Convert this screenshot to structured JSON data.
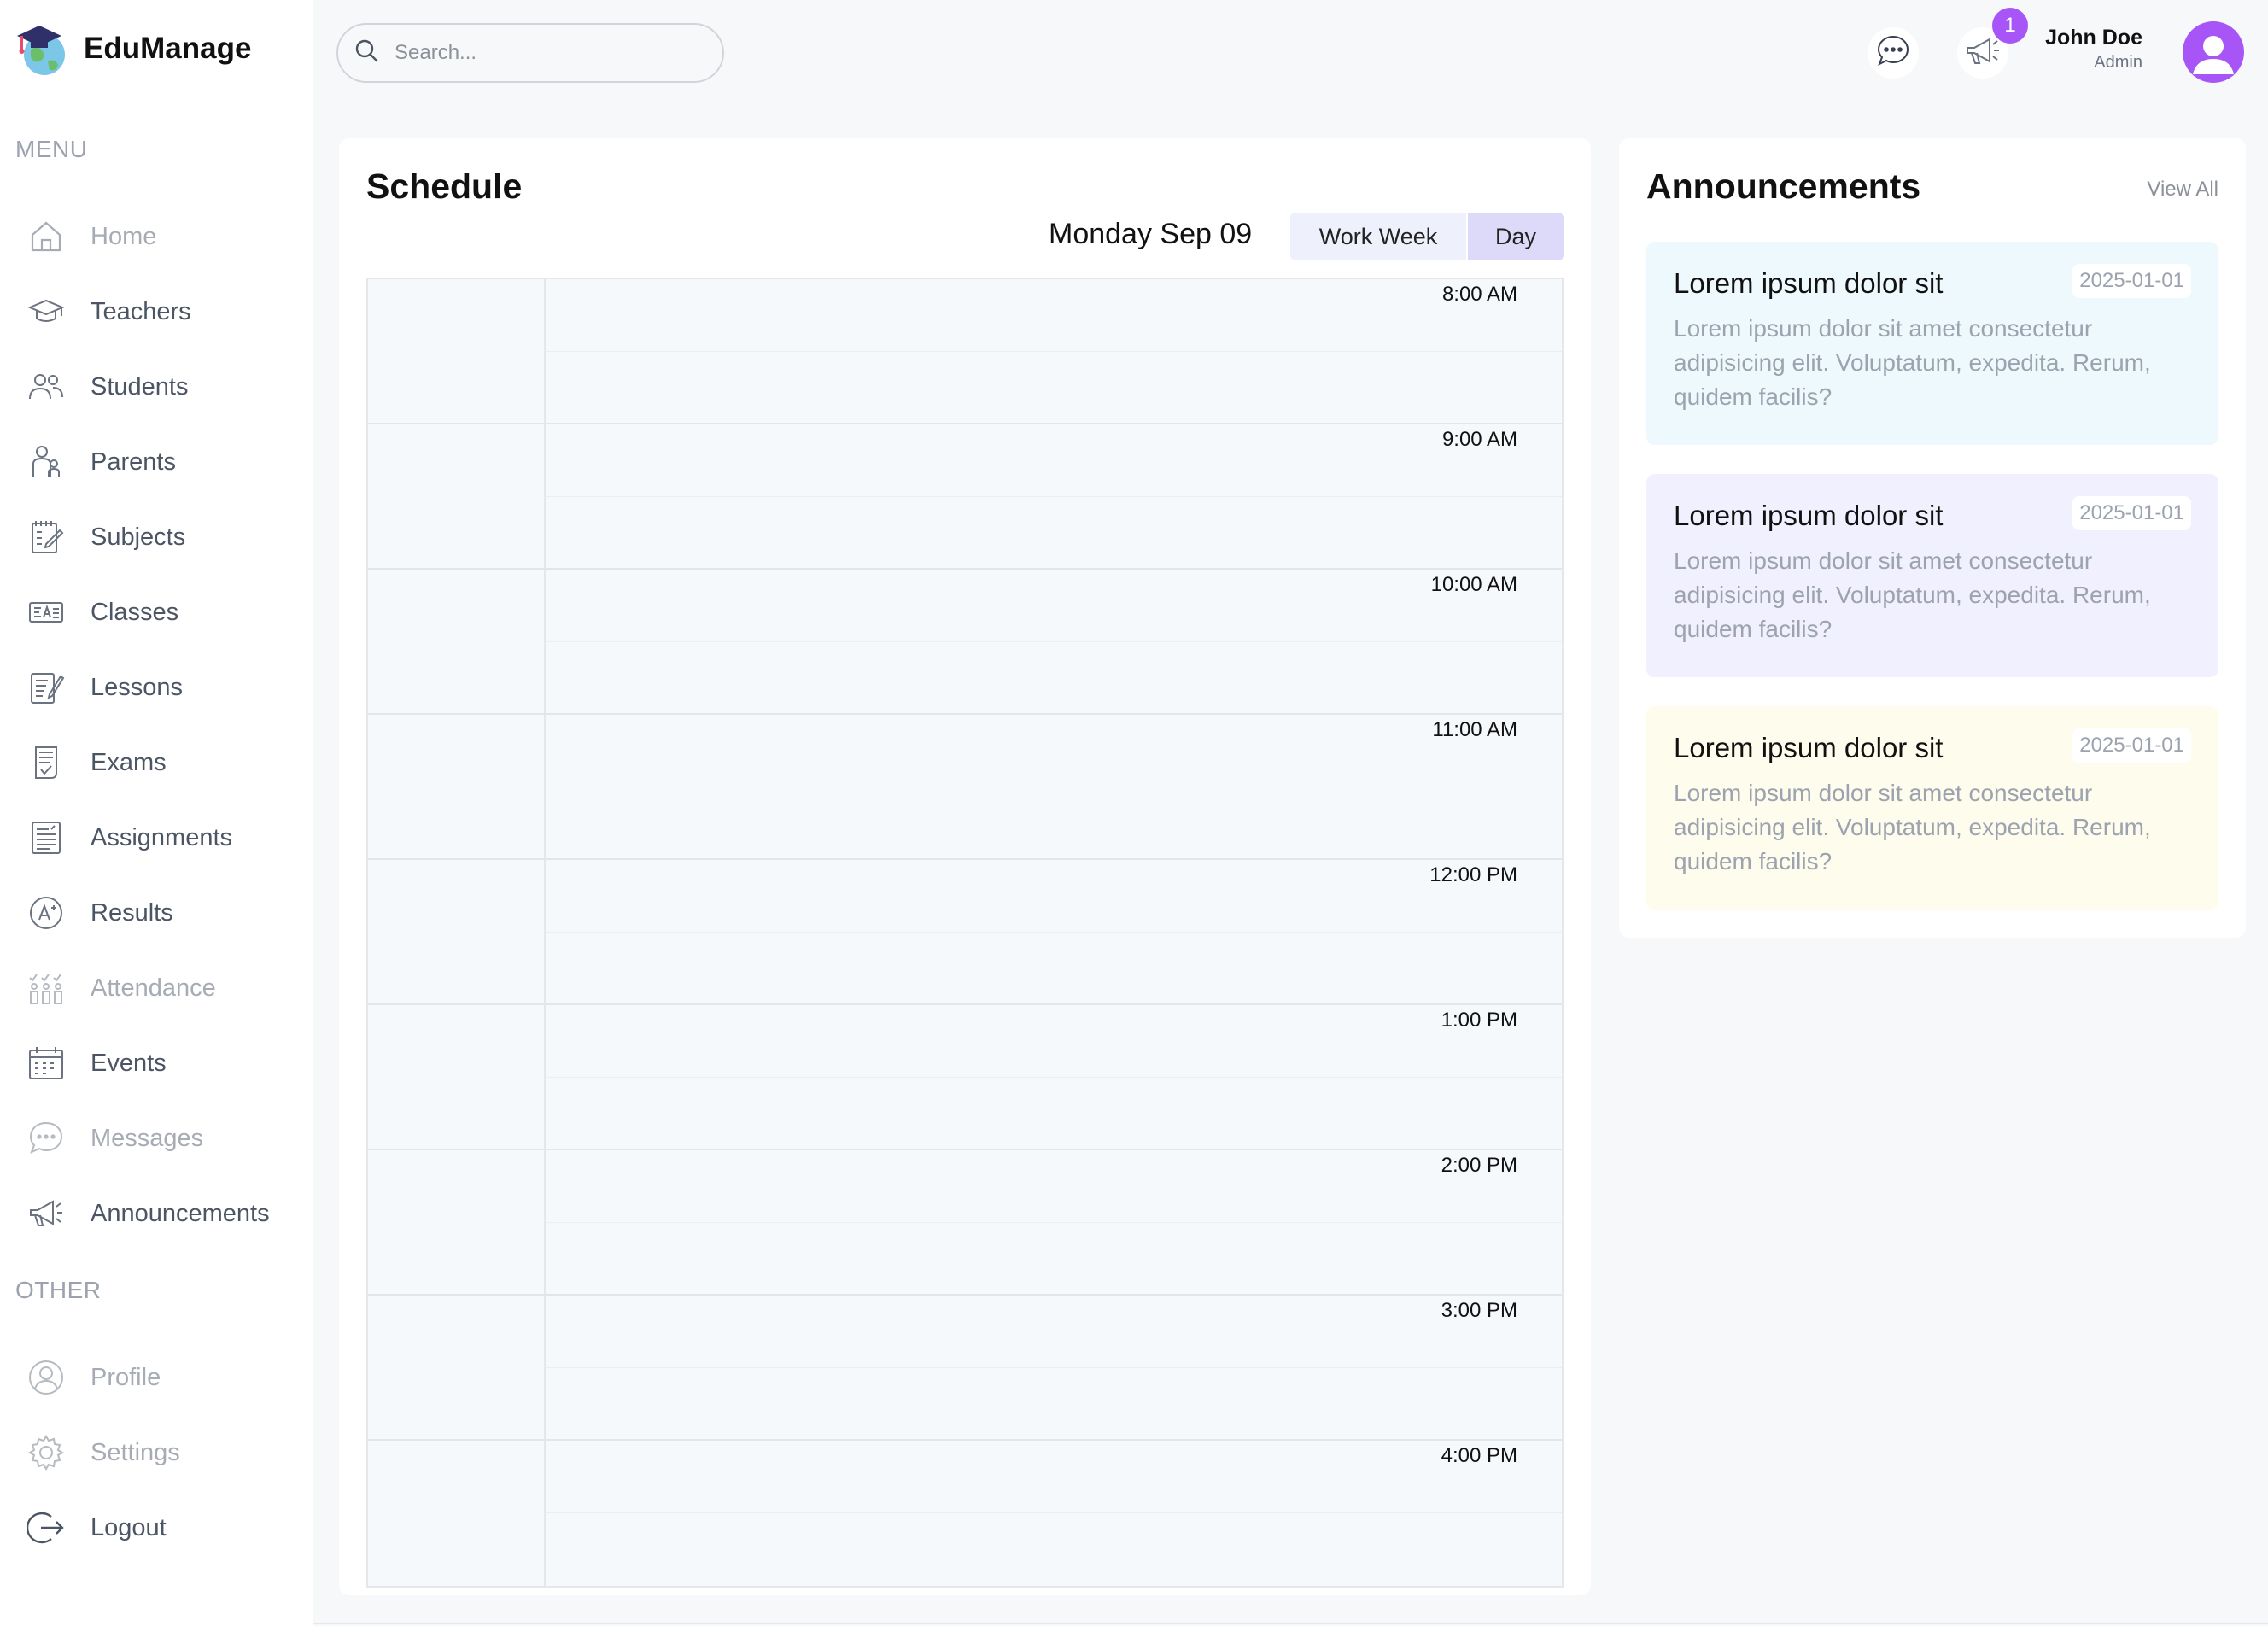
{
  "app": {
    "name": "EduManage"
  },
  "menu": {
    "heading": "MENU",
    "items": [
      {
        "label": "Home",
        "icon": "home-icon"
      },
      {
        "label": "Teachers",
        "icon": "graduation-cap-icon"
      },
      {
        "label": "Students",
        "icon": "users-icon"
      },
      {
        "label": "Parents",
        "icon": "parents-icon"
      },
      {
        "label": "Subjects",
        "icon": "subjects-icon"
      },
      {
        "label": "Classes",
        "icon": "classes-icon"
      },
      {
        "label": "Lessons",
        "icon": "lessons-icon"
      },
      {
        "label": "Exams",
        "icon": "exams-icon"
      },
      {
        "label": "Assignments",
        "icon": "assignments-icon"
      },
      {
        "label": "Results",
        "icon": "results-icon"
      },
      {
        "label": "Attendance",
        "icon": "attendance-icon"
      },
      {
        "label": "Events",
        "icon": "calendar-icon"
      },
      {
        "label": "Messages",
        "icon": "message-icon"
      },
      {
        "label": "Announcements",
        "icon": "megaphone-icon"
      }
    ]
  },
  "other": {
    "heading": "OTHER",
    "items": [
      {
        "label": "Profile",
        "icon": "profile-icon"
      },
      {
        "label": "Settings",
        "icon": "settings-icon"
      },
      {
        "label": "Logout",
        "icon": "logout-icon"
      }
    ]
  },
  "topbar": {
    "search_placeholder": "Search...",
    "notification_count": "1",
    "user_name": "John Doe",
    "user_role": "Admin"
  },
  "schedule": {
    "title": "Schedule",
    "date": "Monday Sep 09",
    "views": [
      "Work Week",
      "Day"
    ],
    "active_view": "Day",
    "times": [
      "8:00 AM",
      "9:00 AM",
      "10:00 AM",
      "11:00 AM",
      "12:00 PM",
      "1:00 PM",
      "2:00 PM",
      "3:00 PM",
      "4:00 PM"
    ]
  },
  "announcements": {
    "title": "Announcements",
    "view_all": "View All",
    "items": [
      {
        "title": "Lorem ipsum dolor sit",
        "date": "2025-01-01",
        "body": "Lorem ipsum dolor sit amet consectetur adipisicing elit. Voluptatum, expedita. Rerum, quidem facilis?",
        "color": "#edf9fd"
      },
      {
        "title": "Lorem ipsum dolor sit",
        "date": "2025-01-01",
        "body": "Lorem ipsum dolor sit amet consectetur adipisicing elit. Voluptatum, expedita. Rerum, quidem facilis?",
        "color": "#f1f0fe"
      },
      {
        "title": "Lorem ipsum dolor sit",
        "date": "2025-01-01",
        "body": "Lorem ipsum dolor sit amet consectetur adipisicing elit. Voluptatum, expedita. Rerum, quidem facilis?",
        "color": "#fefced"
      }
    ]
  },
  "colors": {
    "accent": "#a855f7",
    "view_active": "#dcdaf8",
    "view_inactive": "#eef0fb"
  }
}
